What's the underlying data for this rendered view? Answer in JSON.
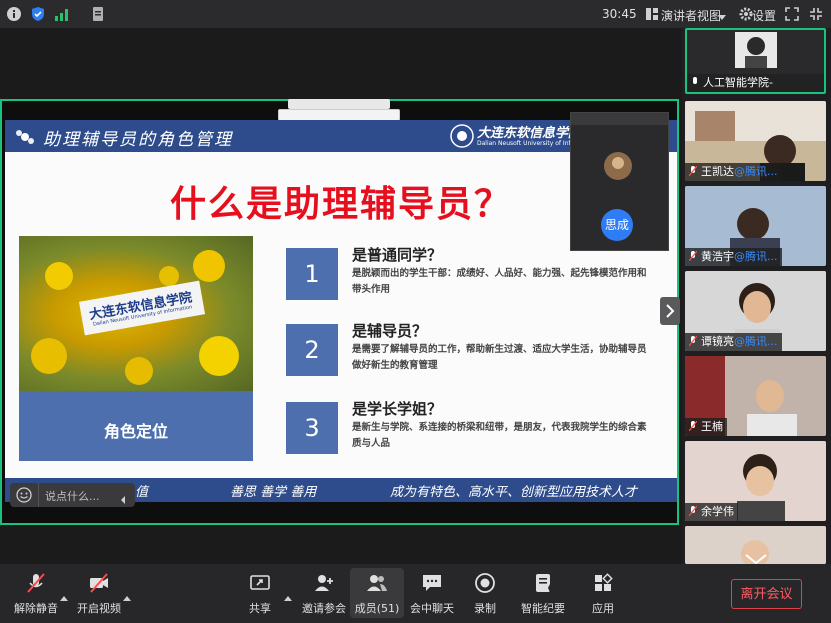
{
  "topbar": {
    "time": "30:45",
    "presenter_view": "演讲者视图",
    "settings": "设置"
  },
  "slide": {
    "header_title": "助理辅导员的角色管理",
    "school_logo_text": "大连东软信息学院",
    "school_logo_en": "Dalian Neusoft University of Information",
    "main_title": "什么是助理辅导员？",
    "photo_sign_cn": "大连东软信息学院",
    "photo_sign_en": "Dalian Neusoft University of Information",
    "role_box_text": "角色定位",
    "items": [
      {
        "num": "1",
        "title": "是普通同学？",
        "desc": "是脱颖而出的学生干部：成绩好、人品好、能力强、起先锋模范作用和带头作用"
      },
      {
        "num": "2",
        "title": "是辅导员？",
        "desc": "是需要了解辅导员的工作，帮助新生过渡、适应大学生活，协助辅导员做好新生的教育管理"
      },
      {
        "num": "3",
        "title": "是学长学姐？",
        "desc": "是新生与学院、系连接的桥梁和纽带，是朋友，代表我院学生的综合素质与人品"
      }
    ],
    "footer_left": "值",
    "footer_motto": "善思  善学  善用",
    "footer_slogan": "成为有特色、高水平、创新型应用技术人才"
  },
  "float_panel": {
    "avatar_name": "思成"
  },
  "chat": {
    "placeholder": "说点什么..."
  },
  "participants": [
    {
      "name": "人工智能学院-",
      "link": ""
    },
    {
      "name": "王凯达",
      "link": "@腾讯..."
    },
    {
      "name": "黄浩宇",
      "link": "@腾讯..."
    },
    {
      "name": "谭镜亮",
      "link": "@腾讯..."
    },
    {
      "name": "王楠",
      "link": ""
    },
    {
      "name": "余学伟",
      "link": ""
    }
  ],
  "toolbar": {
    "unmute": "解除静音",
    "start_video": "开启视频",
    "share": "共享",
    "invite": "邀请参会",
    "members": "成员(51)",
    "chat": "会中聊天",
    "record": "录制",
    "notes": "智能纪要",
    "apps": "应用",
    "leave": "离开会议"
  },
  "colors": {
    "accent_green": "#19c27f",
    "slide_blue": "#2e4c8c",
    "title_red": "#e60f1e",
    "leave_red": "#ff5b62"
  }
}
